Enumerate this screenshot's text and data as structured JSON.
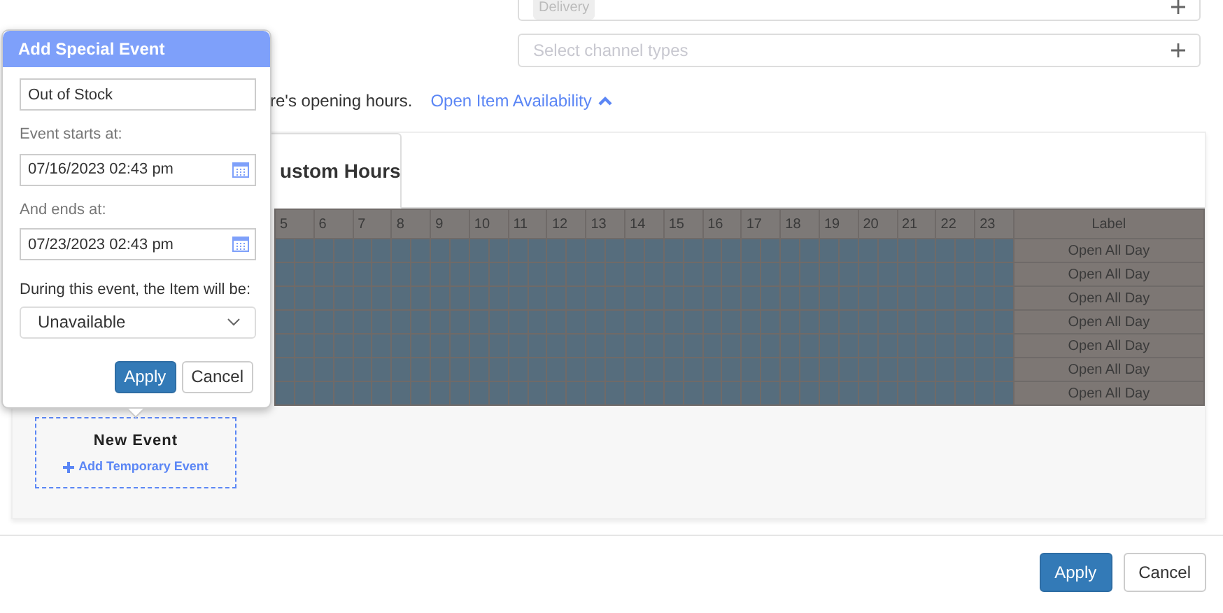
{
  "delivery_field": {
    "chip": "Delivery"
  },
  "channel_field": {
    "placeholder": "Select channel types"
  },
  "note": "re's opening hours.",
  "availability_link": {
    "label": "Open Item Availability",
    "expanded": true
  },
  "tab": {
    "label": "ustom Hours"
  },
  "schedule": {
    "hours": [
      "5",
      "6",
      "7",
      "8",
      "9",
      "10",
      "11",
      "12",
      "13",
      "14",
      "15",
      "16",
      "17",
      "18",
      "19",
      "20",
      "21",
      "22",
      "23"
    ],
    "label_heading": "Label",
    "rows": [
      "Open All Day",
      "Open All Day",
      "Open All Day",
      "Open All Day",
      "Open All Day",
      "Open All Day",
      "Open All Day"
    ]
  },
  "new_event": {
    "title": "New Event",
    "action": "Add Temporary Event"
  },
  "popover": {
    "title": "Add Special Event",
    "name_value": "Out of Stock",
    "start_label": "Event starts at:",
    "start_value": "07/16/2023 02:43 pm",
    "end_label": "And ends at:",
    "end_value": "07/23/2023 02:43 pm",
    "status_label": "During this event, the Item will be:",
    "status_value": "Unavailable",
    "buttons": [
      {
        "label": "Apply",
        "primary": true
      },
      {
        "label": "Cancel",
        "primary": false
      }
    ]
  },
  "footer_buttons": [
    {
      "label": "Apply",
      "primary": true
    },
    {
      "label": "Cancel",
      "primary": false
    }
  ]
}
